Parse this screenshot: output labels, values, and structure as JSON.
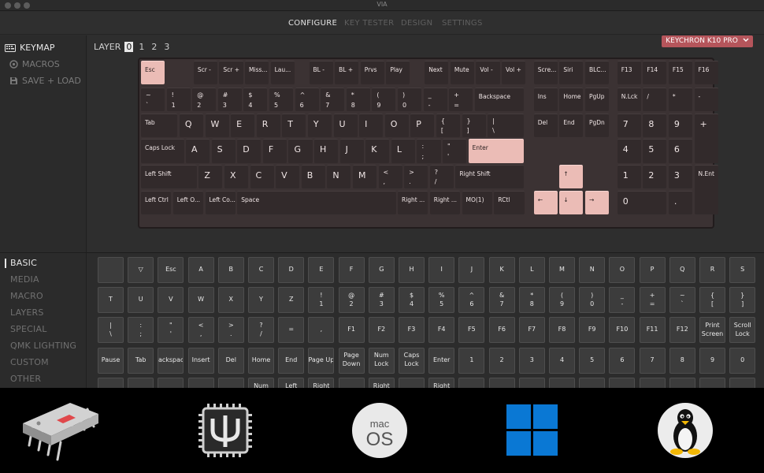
{
  "window": {
    "title": "VIA"
  },
  "nav": {
    "tabs": [
      "CONFIGURE",
      "KEY TESTER",
      "DESIGN",
      "SETTINGS"
    ]
  },
  "sidebar": {
    "items": [
      "KEYMAP",
      "MACROS",
      "SAVE + LOAD"
    ]
  },
  "layer": {
    "label": "LAYER",
    "numbers": [
      "0",
      "1",
      "2",
      "3"
    ],
    "selected": "0"
  },
  "device": {
    "name": "KEYCHRON K10 PRO"
  },
  "keyboard": {
    "rows": [
      [
        "Esc",
        "Scr -",
        "Scr +",
        "Miss...",
        "Lau...",
        "BL -",
        "BL +",
        "Prvs",
        "Play",
        "Next",
        "Mute",
        "Vol -",
        "Vol +",
        "Scre...",
        "Siri",
        "BLC...",
        "F13",
        "F14",
        "F15",
        "F16"
      ],
      [
        "~\n`",
        "!\n1",
        "@\n2",
        "#\n3",
        "$\n4",
        "%\n5",
        "^\n6",
        "&\n7",
        "*\n8",
        "(\n9",
        ")\n0",
        "_\n-",
        "+\n=",
        "Backspace",
        "Ins",
        "Home",
        "PgUp",
        "N.Lck",
        "/",
        "*",
        "-"
      ],
      [
        "Tab",
        "Q",
        "W",
        "E",
        "R",
        "T",
        "Y",
        "U",
        "I",
        "O",
        "P",
        "{\n[",
        "}\n]",
        "|\n\\",
        "Del",
        "End",
        "PgDn",
        "7",
        "8",
        "9",
        "+"
      ],
      [
        "Caps Lock",
        "A",
        "S",
        "D",
        "F",
        "G",
        "H",
        "J",
        "K",
        "L",
        ":\n;",
        "\"\n'",
        "Enter",
        "4",
        "5",
        "6"
      ],
      [
        "Left Shift",
        "Z",
        "X",
        "C",
        "V",
        "B",
        "N",
        "M",
        "<\n,",
        ">\n.",
        "?\n/",
        "Right Shift",
        "↑",
        "1",
        "2",
        "3",
        "N.Ent"
      ],
      [
        "Left Ctrl",
        "Left O...",
        "Left Co...",
        "Space",
        "Right ...",
        "Right ...",
        "MO(1)",
        "RCtl",
        "←",
        "↓",
        "→",
        "0",
        "."
      ]
    ]
  },
  "categories": {
    "items": [
      "BASIC",
      "MEDIA",
      "MACRO",
      "LAYERS",
      "SPECIAL",
      "QMK LIGHTING",
      "CUSTOM",
      "OTHER"
    ]
  },
  "keycodes": {
    "rows": [
      [
        "",
        "▽",
        "Esc",
        "A",
        "B",
        "C",
        "D",
        "E",
        "F",
        "G",
        "H",
        "I",
        "J",
        "K",
        "L",
        "M",
        "N",
        "O",
        "P",
        "Q",
        "R",
        "S"
      ],
      [
        "T",
        "U",
        "V",
        "W",
        "X",
        "Y",
        "Z",
        "!\n1",
        "@\n2",
        "#\n3",
        "$\n4",
        "%\n5",
        "^\n6",
        "&\n7",
        "*\n8",
        "(\n9",
        ")\n0",
        "_\n-",
        "+\n=",
        "~\n`",
        "{\n[",
        "}\n]"
      ],
      [
        "|\n\\",
        ":\n;",
        "\"\n'",
        "<\n,",
        ">\n.",
        "?\n/",
        "=",
        ",",
        "F1",
        "F2",
        "F3",
        "F4",
        "F5",
        "F6",
        "F7",
        "F8",
        "F9",
        "F10",
        "F11",
        "F12",
        "Print\nScreen",
        "Scroll\nLock"
      ],
      [
        "Pause",
        "Tab",
        "Backspace",
        "Insert",
        "Del",
        "Home",
        "End",
        "Page Up",
        "Page\nDown",
        "Num\nLock",
        "Caps\nLock",
        "Enter",
        "1",
        "2",
        "3",
        "4",
        "5",
        "6",
        "7",
        "8",
        "9",
        "0"
      ],
      [
        "",
        "",
        "",
        "",
        "",
        "Num",
        "Left",
        "Right",
        "",
        "Right",
        "",
        "Right",
        "",
        "",
        "",
        "",
        "",
        "",
        "",
        "",
        "",
        ""
      ]
    ]
  },
  "platforms": {
    "items": [
      {
        "name": "chip-icon"
      },
      {
        "name": "psi-chip-icon"
      },
      {
        "name": "macos-icon",
        "text_top": "mac",
        "text_bottom": "OS"
      },
      {
        "name": "windows-icon"
      },
      {
        "name": "linux-icon"
      }
    ]
  },
  "colors": {
    "accent": "#b5555b",
    "key_pink": "#ebbcb6",
    "key_dark": "#322a2b",
    "windows_blue": "#0a78d4"
  }
}
